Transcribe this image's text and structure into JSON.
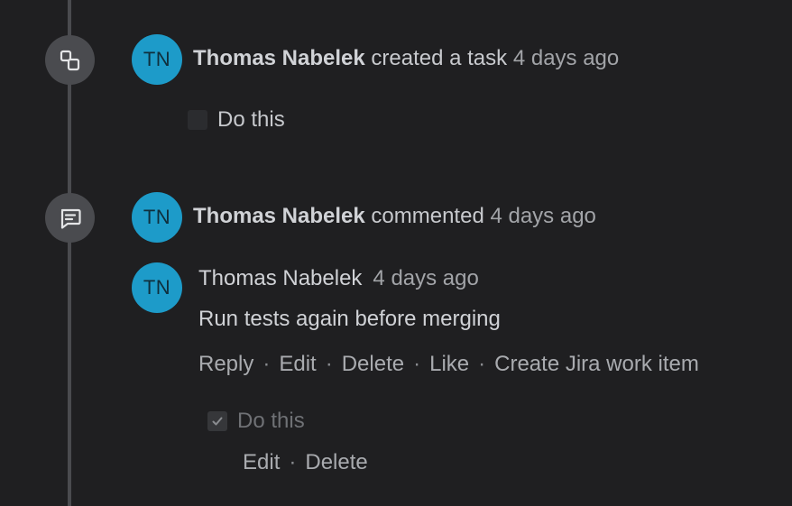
{
  "events": [
    {
      "icon": "task-icon",
      "avatar_initials": "TN",
      "author": "Thomas Nabelek",
      "action": "created a task",
      "time": "4 days ago",
      "task": {
        "label": "Do this",
        "checked": false
      }
    },
    {
      "icon": "comment-icon",
      "avatar_initials": "TN",
      "author": "Thomas Nabelek",
      "action": "commented",
      "time": "4 days ago",
      "comment": {
        "avatar_initials": "TN",
        "author": "Thomas Nabelek",
        "time": "4 days ago",
        "body": "Run tests again before merging",
        "actions": [
          "Reply",
          "Edit",
          "Delete",
          "Like",
          "Create Jira work item"
        ],
        "task": {
          "label": "Do this",
          "checked": true
        },
        "task_actions": [
          "Edit",
          "Delete"
        ]
      }
    }
  ],
  "separator": "·",
  "colors": {
    "background": "#1f1f21",
    "avatar": "#1d9bc9",
    "timeline": "#4a4b4f"
  }
}
